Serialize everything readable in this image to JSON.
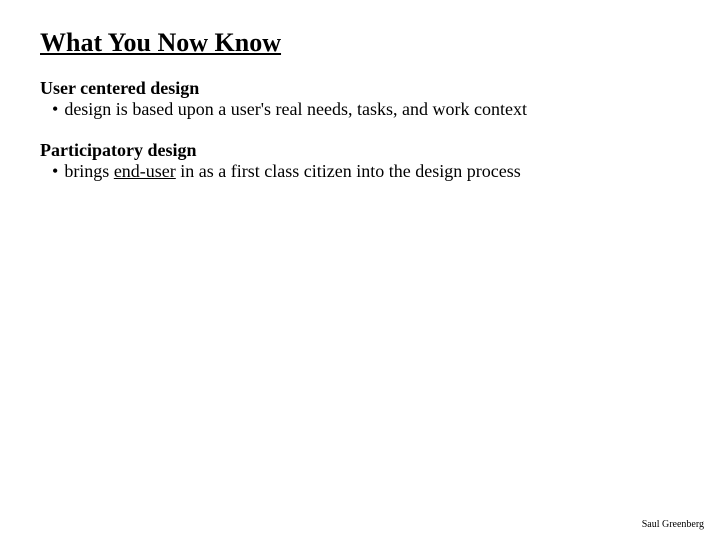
{
  "title": "What You Now Know",
  "sections": [
    {
      "heading": "User centered design",
      "bullet": "design is based upon a user's real needs, tasks, and work context"
    },
    {
      "heading": "Participatory design",
      "bullet_prefix": "brings ",
      "bullet_underlined": "end-user",
      "bullet_suffix": " in as a first class citizen into the design process"
    }
  ],
  "footer": "Saul Greenberg"
}
